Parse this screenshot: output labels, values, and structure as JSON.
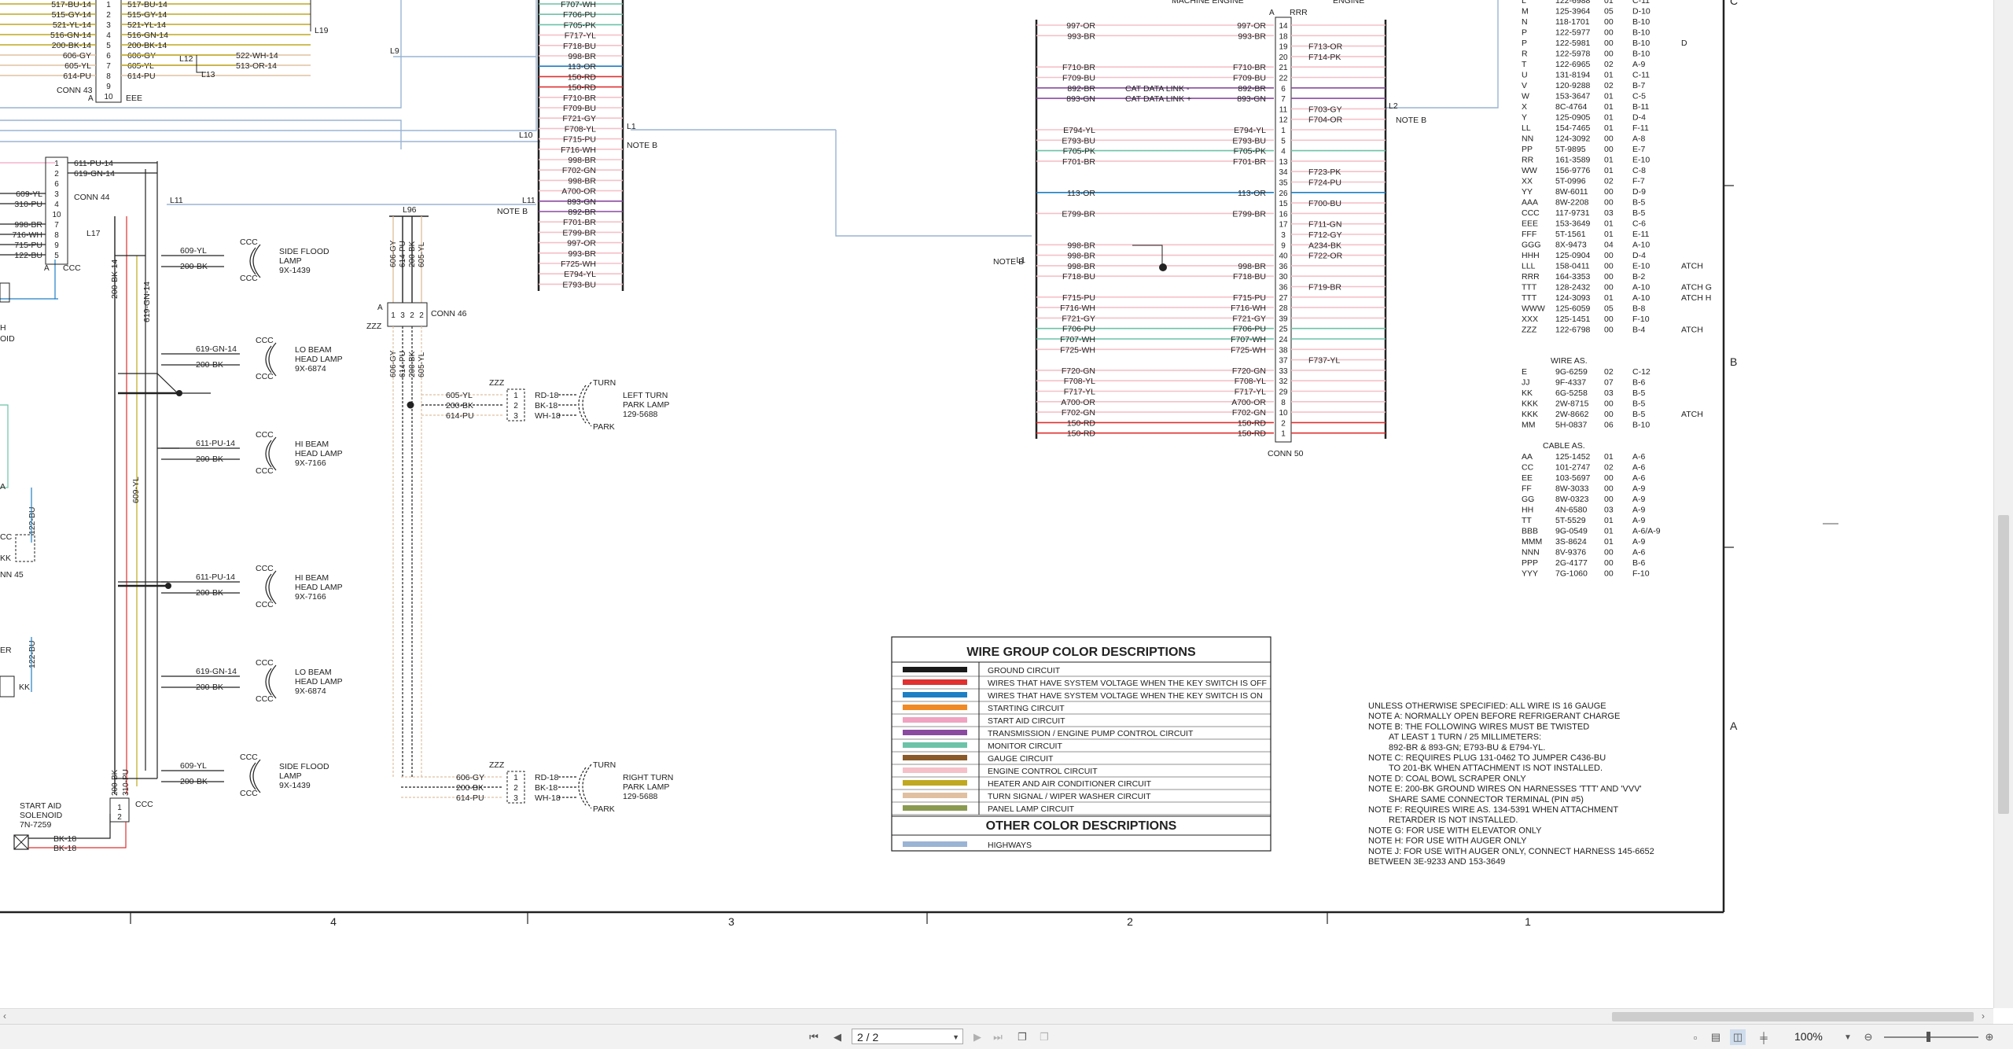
{
  "viewer": {
    "page_indicator": "2 / 2",
    "zoom": "100%"
  },
  "legend": {
    "title": "WIRE GROUP COLOR DESCRIPTIONS",
    "items": [
      {
        "color": "#1a1a1a",
        "label": "GROUND CIRCUIT"
      },
      {
        "color": "#e03030",
        "label": "WIRES THAT HAVE SYSTEM VOLTAGE WHEN THE KEY SWITCH IS OFF"
      },
      {
        "color": "#1d7fc4",
        "label": "WIRES THAT HAVE SYSTEM VOLTAGE WHEN THE KEY SWITCH IS ON"
      },
      {
        "color": "#f08a24",
        "label": "STARTING CIRCUIT"
      },
      {
        "color": "#f0a3c0",
        "label": "START AID CIRCUIT"
      },
      {
        "color": "#8a4aa0",
        "label": "TRANSMISSION / ENGINE PUMP CONTROL CIRCUIT"
      },
      {
        "color": "#6cc3a8",
        "label": "MONITOR CIRCUIT"
      },
      {
        "color": "#8a5a2a",
        "label": "GAUGE CIRCUIT"
      },
      {
        "color": "#f5c0c8",
        "label": "ENGINE CONTROL CIRCUIT"
      },
      {
        "color": "#c0a820",
        "label": "HEATER AND AIR CONDITIONER CIRCUIT"
      },
      {
        "color": "#e0c0a0",
        "label": "TURN SIGNAL / WIPER WASHER CIRCUIT"
      },
      {
        "color": "#8a9a50",
        "label": "PANEL LAMP CIRCUIT"
      }
    ],
    "other_title": "OTHER COLOR DESCRIPTIONS",
    "other_items": [
      {
        "color": "#9ab4d4",
        "label": "HIGHWAYS"
      }
    ]
  },
  "notes": [
    "UNLESS OTHERWISE SPECIFIED: ALL WIRE IS 16 GAUGE",
    "NOTE A: NORMALLY OPEN BEFORE REFRIGERANT CHARGE",
    "NOTE B: THE FOLLOWING WIRES MUST BE TWISTED",
    "AT LEAST 1 TURN / 25 MILLIMETERS:",
    "892-BR & 893-GN; E793-BU & E794-YL.",
    "NOTE C: REQUIRES PLUG 131-0462 TO JUMPER C436-BU",
    "TO 201-BK WHEN ATTACHMENT IS NOT INSTALLED.",
    "NOTE D: COAL BOWL SCRAPER ONLY",
    "NOTE E: 200-BK GROUND WIRES ON HARNESSES 'TTT' AND 'VVV'",
    "SHARE SAME CONNECTOR TERMINAL (PIN #5)",
    "NOTE F: REQUIRES WIRE AS. 134-5391 WHEN ATTACHMENT",
    "RETARDER IS NOT INSTALLED.",
    "NOTE G: FOR USE WITH ELEVATOR ONLY",
    "NOTE H: FOR USE WITH AUGER ONLY",
    "NOTE J: FOR USE WITH AUGER ONLY, CONNECT HARNESS 145-6652",
    "BETWEEN 3E-9233 AND 153-3649"
  ],
  "parts_table": [
    [
      "L",
      "122-6988",
      "01",
      "C-11",
      ""
    ],
    [
      "M",
      "125-3964",
      "05",
      "D-10",
      ""
    ],
    [
      "N",
      "118-1701",
      "00",
      "B-10",
      ""
    ],
    [
      "P",
      "122-5977",
      "00",
      "B-10",
      ""
    ],
    [
      "P",
      "122-5981",
      "00",
      "B-10",
      "D"
    ],
    [
      "R",
      "122-5978",
      "00",
      "B-10",
      ""
    ],
    [
      "T",
      "122-6965",
      "02",
      "A-9",
      ""
    ],
    [
      "U",
      "131-8194",
      "01",
      "C-11",
      ""
    ],
    [
      "V",
      "120-9288",
      "02",
      "B-7",
      ""
    ],
    [
      "W",
      "153-3647",
      "01",
      "C-5",
      ""
    ],
    [
      "X",
      "8C-4764",
      "01",
      "B-11",
      ""
    ],
    [
      "Y",
      "125-0905",
      "01",
      "D-4",
      ""
    ],
    [
      "LL",
      "154-7465",
      "01",
      "F-11",
      ""
    ],
    [
      "NN",
      "124-3092",
      "00",
      "A-8",
      ""
    ],
    [
      "PP",
      "5T-9895",
      "00",
      "E-7",
      ""
    ],
    [
      "RR",
      "161-3589",
      "01",
      "E-10",
      ""
    ],
    [
      "WW",
      "156-9776",
      "01",
      "C-8",
      ""
    ],
    [
      "XX",
      "5T-0996",
      "02",
      "F-7",
      ""
    ],
    [
      "YY",
      "8W-6011",
      "00",
      "D-9",
      ""
    ],
    [
      "AAA",
      "8W-2208",
      "00",
      "B-5",
      ""
    ],
    [
      "CCC",
      "117-9731",
      "03",
      "B-5",
      ""
    ],
    [
      "EEE",
      "153-3649",
      "01",
      "C-6",
      ""
    ],
    [
      "FFF",
      "5T-1561",
      "01",
      "E-11",
      ""
    ],
    [
      "GGG",
      "8X-9473",
      "04",
      "A-10",
      ""
    ],
    [
      "HHH",
      "125-0904",
      "00",
      "D-4",
      ""
    ],
    [
      "LLL",
      "158-0411",
      "00",
      "E-10",
      "ATCH"
    ],
    [
      "RRR",
      "164-3353",
      "00",
      "B-2",
      ""
    ],
    [
      "TTT",
      "128-2432",
      "00",
      "A-10",
      "ATCH G"
    ],
    [
      "TTT",
      "124-3093",
      "01",
      "A-10",
      "ATCH H"
    ],
    [
      "WWW",
      "125-6059",
      "05",
      "B-8",
      ""
    ],
    [
      "XXX",
      "125-1451",
      "00",
      "F-10",
      ""
    ],
    [
      "ZZZ",
      "122-6798",
      "00",
      "B-4",
      "ATCH"
    ]
  ],
  "wire_as_title": "WIRE AS.",
  "wire_as": [
    [
      "E",
      "9G-6259",
      "02",
      "C-12",
      ""
    ],
    [
      "JJ",
      "9F-4337",
      "07",
      "B-6",
      ""
    ],
    [
      "KK",
      "6G-5258",
      "03",
      "B-5",
      ""
    ],
    [
      "KKK",
      "2W-8715",
      "00",
      "B-5",
      ""
    ],
    [
      "KKK",
      "2W-8662",
      "00",
      "B-5",
      "ATCH"
    ],
    [
      "MM",
      "5H-0837",
      "06",
      "B-10",
      ""
    ]
  ],
  "cable_as_title": "CABLE AS.",
  "cable_as": [
    [
      "AA",
      "125-1452",
      "01",
      "A-6"
    ],
    [
      "CC",
      "101-2747",
      "02",
      "A-6"
    ],
    [
      "EE",
      "103-5697",
      "00",
      "A-6"
    ],
    [
      "FF",
      "8W-3033",
      "00",
      "A-9"
    ],
    [
      "GG",
      "8W-0323",
      "00",
      "A-9"
    ],
    [
      "HH",
      "4N-6580",
      "03",
      "A-9"
    ],
    [
      "TT",
      "5T-5529",
      "01",
      "A-9"
    ],
    [
      "BBB",
      "9G-0549",
      "01",
      "A-6/A-9"
    ],
    [
      "MMM",
      "3S-8624",
      "01",
      "A-9"
    ],
    [
      "NNN",
      "8V-9376",
      "00",
      "A-6"
    ],
    [
      "PPP",
      "2G-4177",
      "00",
      "B-6"
    ],
    [
      "YYY",
      "7G-1060",
      "00",
      "F-10"
    ]
  ],
  "conn43_rows": [
    {
      "wire": "517-BU-14",
      "pin": "1",
      "out": "517-BU-14"
    },
    {
      "wire": "515-GY-14",
      "pin": "2",
      "out": "515-GY-14"
    },
    {
      "wire": "521-YL-14",
      "pin": "3",
      "out": "521-YL-14"
    },
    {
      "wire": "516-GN-14",
      "pin": "4",
      "out": "516-GN-14"
    },
    {
      "wire": "200-BK-14",
      "pin": "5",
      "out": "200-BK-14"
    },
    {
      "wire": "606-GY",
      "pin": "6",
      "out": "606-GY"
    },
    {
      "wire": "605-YL",
      "pin": "7",
      "out": "605-YL"
    },
    {
      "wire": "614-PU",
      "pin": "8",
      "out": "614-PU"
    },
    {
      "wire": "",
      "pin": "9",
      "out": ""
    },
    {
      "wire": "",
      "pin": "10",
      "out": ""
    }
  ],
  "conn43_extra": [
    "522-WH-14",
    "513-OR-14"
  ],
  "conn44_rows": [
    {
      "wire": "",
      "pin": "1",
      "out": "611-PU-14"
    },
    {
      "wire": "",
      "pin": "2",
      "out": "619-GN-14"
    },
    {
      "wire": "",
      "pin": "6",
      "out": ""
    },
    {
      "wire": "609-YL",
      "pin": "3",
      "out": ""
    },
    {
      "wire": "310-PU",
      "pin": "4",
      "out": ""
    },
    {
      "wire": "",
      "pin": "10",
      "out": ""
    },
    {
      "wire": "998-BR",
      "pin": "7",
      "out": ""
    },
    {
      "wire": "716-WH",
      "pin": "8",
      "out": ""
    },
    {
      "wire": "715-PU",
      "pin": "9",
      "out": ""
    },
    {
      "wire": "122-BU",
      "pin": "5",
      "out": ""
    }
  ],
  "col1_wires": [
    {
      "label": "F707-WH",
      "color": "#6cc3a8"
    },
    {
      "label": "F706-PU",
      "color": "#6cc3a8"
    },
    {
      "label": "F705-PK",
      "color": "#6cc3a8"
    },
    {
      "label": "F717-YL",
      "color": "#f5c0c8"
    },
    {
      "label": "F718-BU",
      "color": "#f5c0c8"
    },
    {
      "label": "998-BR",
      "color": "#f5c0c8"
    },
    {
      "label": "113-OR",
      "color": "#1d7fc4"
    },
    {
      "label": "150-RD",
      "color": "#e03030"
    },
    {
      "label": "150-RD",
      "color": "#e03030"
    },
    {
      "label": "F710-BR",
      "color": "#f5c0c8"
    },
    {
      "label": "F709-BU",
      "color": "#f5c0c8"
    },
    {
      "label": "F721-GY",
      "color": "#f5c0c8"
    },
    {
      "label": "F708-YL",
      "color": "#f5c0c8"
    },
    {
      "label": "F715-PU",
      "color": "#f5c0c8"
    },
    {
      "label": "F716-WH",
      "color": "#f5c0c8"
    },
    {
      "label": "998-BR",
      "color": "#f5c0c8"
    },
    {
      "label": "F702-GN",
      "color": "#f5c0c8"
    },
    {
      "label": "998-BR",
      "color": "#f5c0c8"
    },
    {
      "label": "A700-OR",
      "color": "#f5c0c8"
    },
    {
      "label": "893-GN",
      "color": "#8a4aa0"
    },
    {
      "label": "892-BR",
      "color": "#8a4aa0"
    },
    {
      "label": "F701-BR",
      "color": "#f5c0c8"
    },
    {
      "label": "E799-BR",
      "color": "#f5c0c8"
    },
    {
      "label": "997-OR",
      "color": "#f5c0c8"
    },
    {
      "label": "993-BR",
      "color": "#f5c0c8"
    },
    {
      "label": "F725-WH",
      "color": "#f5c0c8"
    },
    {
      "label": "E794-YL",
      "color": "#f5c0c8"
    },
    {
      "label": "E793-BU",
      "color": "#f5c0c8"
    }
  ],
  "conn50_title": "MACHINE ENGINE",
  "conn50_right_title": "ENGINE",
  "conn50_label": "CONN 50",
  "rrr_label": "RRR",
  "conn50_rows": [
    {
      "left": "997-OR",
      "mid": "997-OR",
      "pin": "14",
      "right": "",
      "color": "#f5c0c8"
    },
    {
      "left": "993-BR",
      "mid": "993-BR",
      "pin": "18",
      "right": "",
      "color": "#f5c0c8"
    },
    {
      "left": "",
      "mid": "",
      "pin": "19",
      "right": "F713-OR",
      "color": "#f5c0c8"
    },
    {
      "left": "",
      "mid": "",
      "pin": "20",
      "right": "F714-PK",
      "color": "#f5c0c8"
    },
    {
      "left": "F710-BR",
      "mid": "F710-BR",
      "pin": "21",
      "right": "",
      "color": "#f5c0c8"
    },
    {
      "left": "F709-BU",
      "mid": "F709-BU",
      "pin": "22",
      "right": "",
      "color": "#f5c0c8"
    },
    {
      "left": "892-BR",
      "mid": "892-BR",
      "pin": "6",
      "right": "",
      "color": "#8a4aa0",
      "tag": "CAT DATA LINK -"
    },
    {
      "left": "893-GN",
      "mid": "893-GN",
      "pin": "7",
      "right": "",
      "color": "#8a4aa0",
      "tag": "CAT DATA LINK +"
    },
    {
      "left": "",
      "mid": "",
      "pin": "11",
      "right": "F703-GY",
      "color": "#f5c0c8"
    },
    {
      "left": "",
      "mid": "",
      "pin": "12",
      "right": "F704-OR",
      "color": "#f5c0c8"
    },
    {
      "left": "E794-YL",
      "mid": "E794-YL",
      "pin": "1",
      "right": "",
      "color": "#f5c0c8"
    },
    {
      "left": "E793-BU",
      "mid": "E793-BU",
      "pin": "5",
      "right": "",
      "color": "#f5c0c8"
    },
    {
      "left": "F705-PK",
      "mid": "F705-PK",
      "pin": "4",
      "right": "",
      "color": "#6cc3a8"
    },
    {
      "left": "F701-BR",
      "mid": "F701-BR",
      "pin": "13",
      "right": "",
      "color": "#f5c0c8"
    },
    {
      "left": "",
      "mid": "",
      "pin": "34",
      "right": "F723-PK",
      "color": "#f5c0c8"
    },
    {
      "left": "",
      "mid": "",
      "pin": "35",
      "right": "F724-PU",
      "color": "#f5c0c8"
    },
    {
      "left": "113-OR",
      "mid": "113-OR",
      "pin": "26",
      "right": "",
      "color": "#1d7fc4"
    },
    {
      "left": "",
      "mid": "",
      "pin": "15",
      "right": "F700-BU",
      "color": "#f5c0c8"
    },
    {
      "left": "E799-BR",
      "mid": "E799-BR",
      "pin": "16",
      "right": "",
      "color": "#f5c0c8"
    },
    {
      "left": "",
      "mid": "",
      "pin": "17",
      "right": "F711-GN",
      "color": "#f5c0c8"
    },
    {
      "left": "",
      "mid": "",
      "pin": "3",
      "right": "F712-GY",
      "color": "#f5c0c8"
    },
    {
      "left": "998-BR",
      "mid": "",
      "pin": "9",
      "right": "A234-BK",
      "color": "#f5c0c8"
    },
    {
      "left": "998-BR",
      "mid": "",
      "pin": "40",
      "right": "F722-OR",
      "color": "#f5c0c8"
    },
    {
      "left": "998-BR",
      "mid": "998-BR",
      "pin": "36",
      "right": "",
      "color": "#f5c0c8"
    },
    {
      "left": "F718-BU",
      "mid": "F718-BU",
      "pin": "30",
      "right": "",
      "color": "#f5c0c8"
    },
    {
      "left": "",
      "mid": "",
      "pin": "36",
      "right": "F719-BR",
      "color": "#f5c0c8"
    },
    {
      "left": "F715-PU",
      "mid": "F715-PU",
      "pin": "27",
      "right": "",
      "color": "#f5c0c8"
    },
    {
      "left": "F716-WH",
      "mid": "F716-WH",
      "pin": "28",
      "right": "",
      "color": "#f5c0c8"
    },
    {
      "left": "F721-GY",
      "mid": "F721-GY",
      "pin": "39",
      "right": "",
      "color": "#f5c0c8"
    },
    {
      "left": "F706-PU",
      "mid": "F706-PU",
      "pin": "25",
      "right": "",
      "color": "#6cc3a8"
    },
    {
      "left": "F707-WH",
      "mid": "F707-WH",
      "pin": "24",
      "right": "",
      "color": "#6cc3a8"
    },
    {
      "left": "F725-WH",
      "mid": "F725-WH",
      "pin": "38",
      "right": "",
      "color": "#f5c0c8"
    },
    {
      "left": "",
      "mid": "",
      "pin": "37",
      "right": "F737-YL",
      "color": "#f5c0c8"
    },
    {
      "left": "F720-GN",
      "mid": "F720-GN",
      "pin": "33",
      "right": "",
      "color": "#f5c0c8"
    },
    {
      "left": "F708-YL",
      "mid": "F708-YL",
      "pin": "32",
      "right": "",
      "color": "#f5c0c8"
    },
    {
      "left": "F717-YL",
      "mid": "F717-YL",
      "pin": "29",
      "right": "",
      "color": "#f5c0c8"
    },
    {
      "left": "A700-OR",
      "mid": "A700-OR",
      "pin": "8",
      "right": "",
      "color": "#f5c0c8"
    },
    {
      "left": "F702-GN",
      "mid": "F702-GN",
      "pin": "10",
      "right": "",
      "color": "#f5c0c8"
    },
    {
      "left": "150-RD",
      "mid": "150-RD",
      "pin": "2",
      "right": "",
      "color": "#e03030"
    },
    {
      "left": "150-RD",
      "mid": "150-RD",
      "pin": "1",
      "right": "",
      "color": "#e03030"
    }
  ],
  "lamps": [
    {
      "code": "CCC",
      "wire1": "609-YL",
      "wire2": "200-BK",
      "title": [
        "SIDE FLOOD",
        "LAMP",
        "9X-1439"
      ]
    },
    {
      "code": "CCC",
      "wire1": "619-GN-14",
      "wire2": "200-BK",
      "title": [
        "LO BEAM",
        "HEAD LAMP",
        "9X-6874"
      ]
    },
    {
      "code": "CCC",
      "wire1": "611-PU-14",
      "wire2": "200-BK",
      "title": [
        "HI BEAM",
        "HEAD LAMP",
        "9X-7166"
      ]
    },
    {
      "code": "CCC",
      "wire1": "611-PU-14",
      "wire2": "200-BK",
      "title": [
        "HI BEAM",
        "HEAD LAMP",
        "9X-7166"
      ]
    },
    {
      "code": "CCC",
      "wire1": "619-GN-14",
      "wire2": "200-BK",
      "title": [
        "LO BEAM",
        "HEAD LAMP",
        "9X-6874"
      ]
    },
    {
      "code": "CCC",
      "wire1": "609-YL",
      "wire2": "200-BK",
      "title": [
        "SIDE FLOOD",
        "LAMP",
        "9X-1439"
      ]
    }
  ],
  "turn_lamps": [
    {
      "code": "ZZZ",
      "wires": [
        "605-YL",
        "200-BK",
        "614-PU"
      ],
      "pins": [
        "1",
        "2",
        "3"
      ],
      "outs": [
        "RD-18",
        "BK-18",
        "WH-18"
      ],
      "top": "TURN",
      "bottom": "PARK",
      "title": [
        "LEFT TURN",
        "PARK LAMP",
        "129-5688"
      ]
    },
    {
      "code": "ZZZ",
      "wires": [
        "606-GY",
        "200-BK",
        "614-PU"
      ],
      "pins": [
        "1",
        "2",
        "3"
      ],
      "outs": [
        "RD-18",
        "BK-18",
        "WH-18"
      ],
      "top": "TURN",
      "bottom": "PARK",
      "title": [
        "RIGHT TURN",
        "PARK LAMP",
        "129-5688"
      ]
    }
  ],
  "conn46": {
    "label": "CONN 46",
    "code": "ZZZ",
    "wires": [
      "606-GY",
      "614-PU",
      "200-BK",
      "605-YL"
    ],
    "pins": [
      "1",
      "3",
      "2",
      "2"
    ],
    "below": [
      "606-GY",
      "614-PU",
      "200-BK",
      "605-YL"
    ]
  },
  "labels": {
    "conn43": "CONN 43",
    "conn44": "CONN 44",
    "conn45": "NN 45",
    "eee": "EEE",
    "ccc": "CCC",
    "note_b": "NOTE B",
    "l1": "L1",
    "l2": "L2",
    "l9": "L9",
    "l10": "L10",
    "l11": "L11",
    "l12": "L12",
    "l13": "L13",
    "l17": "L17",
    "l19": "L19",
    "l96": "L96",
    "start_aid": [
      "START AID",
      "SOLENOID",
      "7N-7259"
    ],
    "bk18": "BK-18",
    "kk": "KK",
    "v200bk14": "200-BK-14",
    "v619gn14": "619-GN-14",
    "v609yl": "609-YL",
    "v122bu": "122-BU",
    "v200bk": "200-BK",
    "v310pu": "310-PU",
    "a": "A",
    "left_frag": [
      "H",
      "OID",
      "A",
      "CC",
      "KK",
      "ER"
    ]
  },
  "grid": {
    "columns": [
      "4",
      "3",
      "2",
      "1"
    ],
    "rows": [
      "C",
      "B",
      "A"
    ]
  }
}
